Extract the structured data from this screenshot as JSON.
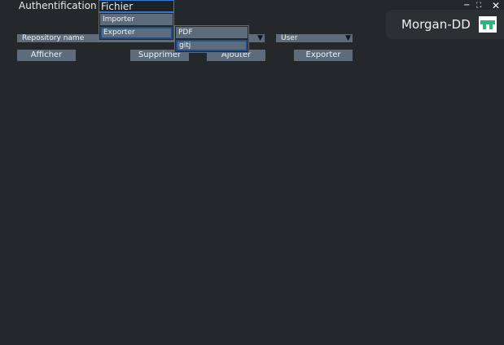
{
  "menubar": {
    "authentification": "Authentification",
    "fichier": "Fichier"
  },
  "window": {
    "minimize": "−",
    "maximize": "⛶",
    "close": "✕"
  },
  "profile": {
    "name": "Morgan-DD"
  },
  "controls": {
    "repository_select": "Repository name",
    "user_select": "User",
    "afficher": "Afficher",
    "supprimer": "Supprimer",
    "ajouter": "Ajouter",
    "exporter": "Exporter"
  },
  "fichier_menu": {
    "items": [
      "Importer",
      "Exporter"
    ]
  },
  "exporter_submenu": {
    "items": [
      "PDF",
      "gitj"
    ]
  },
  "colors": {
    "background": "#24282b",
    "control": "#5d6b7a",
    "selection_border": "#1d4f8f",
    "logo_green": "#2bb67a"
  },
  "icons": [
    "minimize-icon",
    "maximize-icon",
    "close-icon",
    "dropdown-arrow-icon",
    "app-logo-icon"
  ]
}
